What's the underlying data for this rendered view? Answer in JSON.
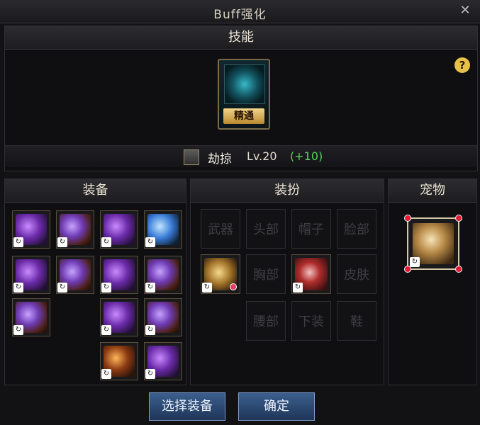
{
  "window": {
    "title": "Buff强化",
    "close_glyph": "✕"
  },
  "skill_section": {
    "header": "技能",
    "badge": "精通",
    "help_glyph": "?",
    "skill_name": "劫掠",
    "level_text": "Lv.20",
    "bonus_text": "(+10)"
  },
  "equipment_section": {
    "header": "装备",
    "slots": [
      {
        "art": "purple"
      },
      {
        "art": "mixed"
      },
      {
        "art": "purple"
      },
      {
        "art": "blue"
      },
      {
        "art": "purple"
      },
      {
        "art": "mixed"
      },
      {
        "art": "purple"
      },
      {
        "art": "mixed"
      },
      {
        "art": "mixed"
      },
      {
        "art": "purple"
      },
      {
        "art": "mixed"
      },
      {
        "art": "orange"
      },
      {
        "art": "purple"
      }
    ],
    "refresh_glyph": "↻"
  },
  "costume_section": {
    "header": "装扮",
    "row1": [
      "武器",
      "头部",
      "帽子",
      "脸部"
    ],
    "row2": [
      "",
      "胸部",
      "",
      "皮肤"
    ],
    "row3": [
      "腰部",
      "下装",
      "鞋"
    ]
  },
  "pet_section": {
    "header": "宠物"
  },
  "buttons": {
    "select_equipment": "选择装备",
    "confirm": "确定"
  },
  "colors": {
    "bonus_green": "#52d45a",
    "button_blue": "#2a4a78",
    "gold": "#d6b36a"
  }
}
